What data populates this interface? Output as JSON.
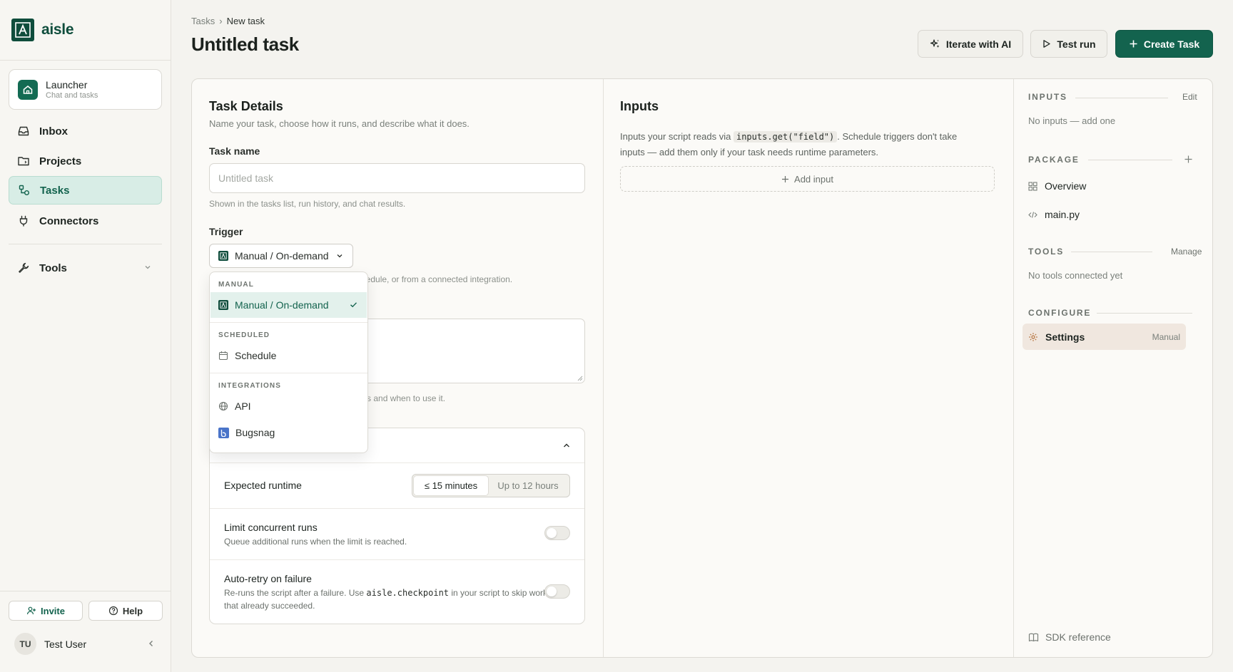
{
  "brand": {
    "name": "aisle"
  },
  "sidebar": {
    "launcher": {
      "title": "Launcher",
      "subtitle": "Chat and tasks"
    },
    "items": [
      {
        "label": "Inbox",
        "icon": "inbox-icon"
      },
      {
        "label": "Projects",
        "icon": "folder-icon"
      },
      {
        "label": "Tasks",
        "icon": "tasks-icon",
        "active": true
      },
      {
        "label": "Connectors",
        "icon": "plug-icon"
      },
      {
        "label": "Tools",
        "icon": "wrench-icon"
      }
    ],
    "invite_label": "Invite",
    "help_label": "Help",
    "user": {
      "initials": "TU",
      "name": "Test User"
    }
  },
  "header": {
    "breadcrumb": [
      "Tasks",
      "New task"
    ],
    "title": "Untitled task",
    "iterate_label": "Iterate with AI",
    "test_run_label": "Test run",
    "create_label": "Create Task"
  },
  "details": {
    "title": "Task Details",
    "subtitle": "Name your task, choose how it runs, and describe what it does.",
    "name_label": "Task name",
    "name_placeholder": "Untitled task",
    "name_hint": "Shown in the tasks list, run history, and chat results.",
    "trigger_label": "Trigger",
    "trigger_value": "Manual / On-demand",
    "trigger_hint_fragment": "schedule, or from a connected integration.",
    "description_hint_fragment": "does and when to use it.",
    "advanced": {
      "runtime_label": "Expected runtime",
      "runtime_options": [
        "≤ 15 minutes",
        "Up to 12 hours"
      ],
      "runtime_selected": "≤ 15 minutes",
      "concurrent_label": "Limit concurrent runs",
      "concurrent_sub": "Queue additional runs when the limit is reached.",
      "concurrent_on": false,
      "retry_label": "Auto-retry on failure",
      "retry_sub_pre": "Re-runs the script after a failure. Use ",
      "retry_sub_code": "aisle.checkpoint",
      "retry_sub_post": " in your script to skip work that already succeeded.",
      "retry_on": false
    }
  },
  "trigger_menu": {
    "groups": [
      {
        "heading": "MANUAL",
        "items": [
          {
            "label": "Manual / On-demand",
            "selected": true
          }
        ]
      },
      {
        "heading": "SCHEDULED",
        "items": [
          {
            "label": "Schedule"
          }
        ]
      },
      {
        "heading": "INTEGRATIONS",
        "items": [
          {
            "label": "API"
          },
          {
            "label": "Bugsnag"
          }
        ]
      }
    ]
  },
  "inputs": {
    "title": "Inputs",
    "desc_pre": "Inputs your script reads via ",
    "desc_code": "inputs.get(\"field\")",
    "desc_post": ". Schedule triggers don't take inputs — add them only if your task needs runtime parameters.",
    "add_label": "Add input"
  },
  "panel": {
    "inputs_heading": "INPUTS",
    "inputs_action": "Edit",
    "inputs_empty": "No inputs — add one",
    "package_heading": "PACKAGE",
    "package_items": [
      "Overview",
      "main.py"
    ],
    "tools_heading": "TOOLS",
    "tools_action": "Manage",
    "tools_empty": "No tools connected yet",
    "configure_heading": "CONFIGURE",
    "settings_label": "Settings",
    "settings_badge": "Manual",
    "sdk_label": "SDK reference"
  },
  "colors": {
    "accent": "#13634e",
    "brand": "#0f4d3c",
    "active_bg": "#d8ede6"
  }
}
